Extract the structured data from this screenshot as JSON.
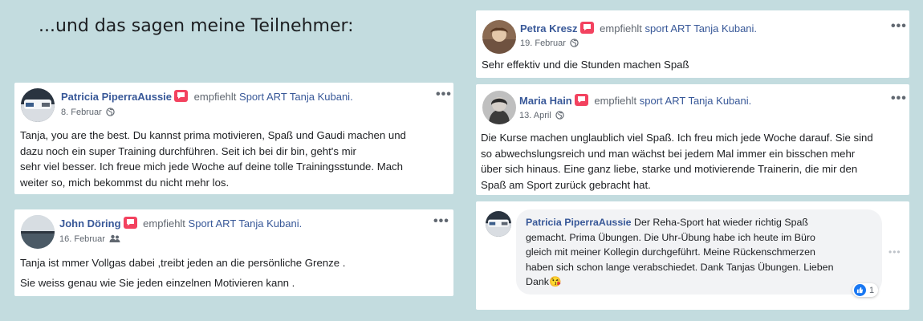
{
  "heading": "...und das sagen meine Teilnehmer:",
  "colors": {
    "background": "#c3dcdf",
    "link": "#385898",
    "badge": "#f3425f",
    "like": "#1877f2"
  },
  "reviews": [
    {
      "name": "Patricia PiperraAussie",
      "action": "empfiehlt",
      "page": "Sport ART Tanja Kubani.",
      "date": "8. Februar",
      "privacy_icon": "globe-icon",
      "lines": [
        "Tanja, you are the best. Du kannst prima motivieren, Spaß und Gaudi machen und",
        "dazu noch ein super Training durchführen. Seit ich bei dir bin, geht's mir",
        "sehr viel besser. Ich freue mich jede Woche auf deine tolle Trainingsstunde. Mach",
        "weiter so, mich bekommst du nicht mehr los."
      ]
    },
    {
      "name": "John Döring",
      "action": "empfiehlt",
      "page": "Sport ART Tanja Kubani.",
      "date": "16. Februar",
      "privacy_icon": "friends-icon",
      "lines": [
        "Tanja ist mmer Vollgas dabei ,treibt jeden an die persönliche Grenze .",
        "Sie weiss genau wie Sie jeden einzelnen Motivieren kann ."
      ]
    },
    {
      "name": "Petra Kresz",
      "action": "empfiehlt",
      "page": "sport ART Tanja Kubani.",
      "date": "19. Februar",
      "privacy_icon": "globe-icon",
      "lines": [
        "Sehr effektiv und die Stunden machen Spaß"
      ]
    },
    {
      "name": "Maria Hain",
      "action": "empfiehlt",
      "page": "sport ART Tanja Kubani.",
      "date": "13. April",
      "privacy_icon": "globe-icon",
      "lines": [
        "Die Kurse machen unglaublich viel Spaß. Ich freu mich jede Woche darauf. Sie sind",
        "so abwechslungsreich und man wächst bei jedem Mal immer ein bisschen mehr",
        "über sich hinaus. Eine ganz liebe, starke und motivierende Trainerin, die mir den",
        "Spaß am Sport zurück gebracht hat."
      ]
    }
  ],
  "comment": {
    "name": "Patricia PiperraAussie",
    "lines": [
      "Der Reha-Sport hat wieder richtig Spaß",
      "gemacht. Prima Übungen. Die Uhr-Übung habe ich heute im Büro",
      "gleich mit meiner Kollegin durchgeführt. Meine Rückenschmerzen",
      "haben sich schon lange verabschiedet. Dank Tanjas Übungen. Lieben",
      "Dank"
    ],
    "emoji": "😘",
    "reaction_count": "1"
  }
}
